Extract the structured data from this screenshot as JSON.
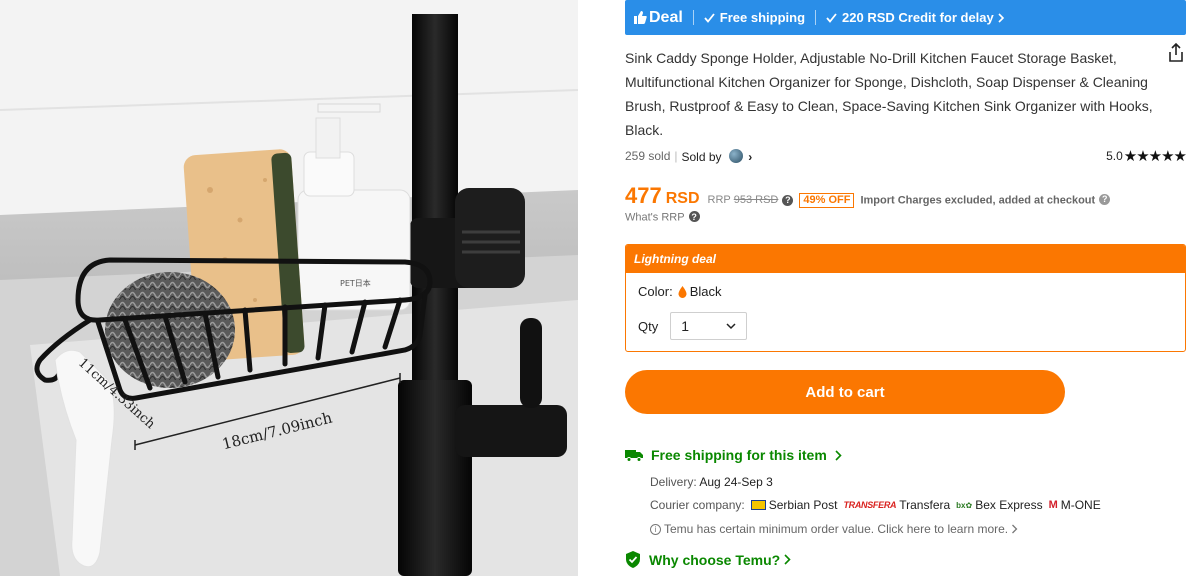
{
  "product_image": {
    "dimension_length": "18cm/7.09inch",
    "dimension_width": "11cm/4.33inch",
    "bottle_label": "PET日本"
  },
  "deal_banner": {
    "deal_label": "Deal",
    "free_shipping": "Free shipping",
    "credit": "220 RSD Credit for delay"
  },
  "product": {
    "title": "Sink Caddy Sponge Holder, Adjustable No-Drill Kitchen Faucet Storage Basket, Multifunctional Kitchen Organizer for Sponge, Dishcloth, Soap Dispenser & Cleaning Brush, Rustproof & Easy to Clean, Space-Saving Kitchen Sink Organizer with Hooks, Black.",
    "sold_count": "259 sold",
    "sold_by": "Sold by",
    "rating_value": "5.0",
    "stars": "★★★★★"
  },
  "pricing": {
    "price": "477",
    "currency": "RSD",
    "rrp_label": "RRP",
    "rrp_value": "953 RSD",
    "discount": "49% OFF",
    "import_note": "Import Charges excluded, added at checkout",
    "whats_rrp": "What's RRP"
  },
  "lightning": {
    "header": "Lightning deal",
    "color_label": "Color:",
    "color_value": "Black",
    "qty_label": "Qty",
    "qty_value": "1"
  },
  "actions": {
    "add_to_cart": "Add to cart"
  },
  "shipping": {
    "title": "Free shipping for this item",
    "delivery_label": "Delivery:",
    "delivery_value": "Aug 24-Sep 3",
    "courier_label": "Courier company:",
    "couriers": [
      "Serbian Post",
      "Transfera",
      "Bex Express",
      "M-ONE"
    ],
    "courier_logo_text": "TRANSFERA",
    "min_order_note": "Temu has certain minimum order value. Click here to learn more.",
    "why_temu": "Why choose Temu?"
  },
  "colors": {
    "accent_orange": "#fb7701",
    "banner_blue": "#2a8ee8",
    "trust_green": "#0a8800"
  }
}
